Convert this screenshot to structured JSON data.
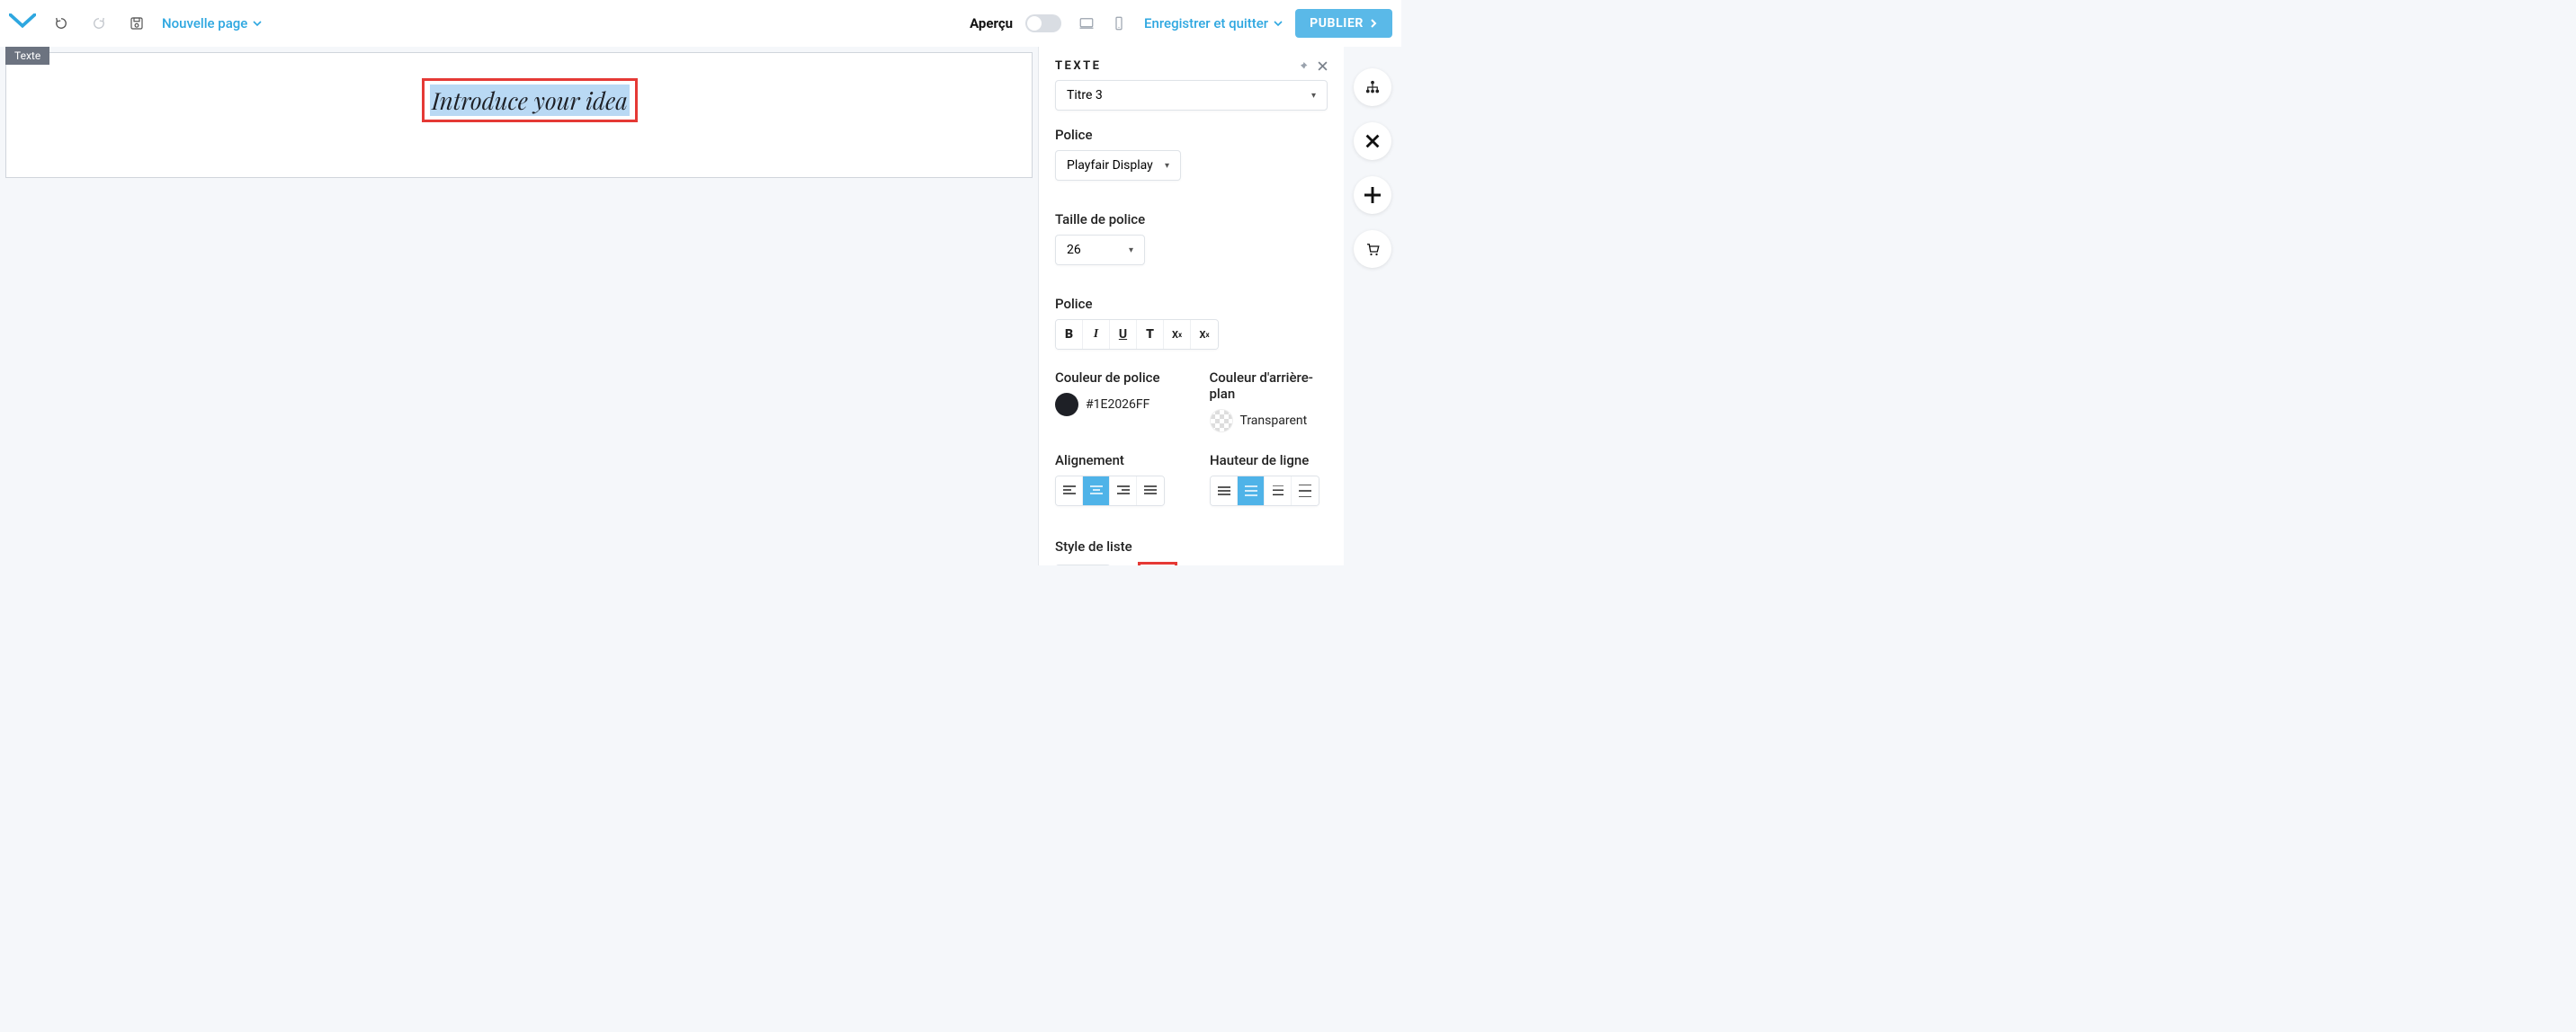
{
  "topbar": {
    "nouvelle_page": "Nouvelle page",
    "apercu": "Aperçu",
    "save_exit": "Enregistrer et quitter",
    "publish": "PUBLIER"
  },
  "canvas": {
    "element_tag": "Texte",
    "text_content": "Introduce your idea"
  },
  "panel": {
    "title": "TEXTE",
    "heading_select": "Titre 3",
    "label_police": "Police",
    "font_value": "Playfair Display",
    "label_taille": "Taille de police",
    "size_value": "26",
    "label_style": "Police",
    "label_font_color": "Couleur de police",
    "font_color_value": "#1E2026FF",
    "label_bg_color": "Couleur d'arrière-plan",
    "bg_color_value": "Transparent",
    "label_align": "Alignement",
    "label_lineheight": "Hauteur de ligne",
    "label_liststyle": "Style de liste"
  }
}
